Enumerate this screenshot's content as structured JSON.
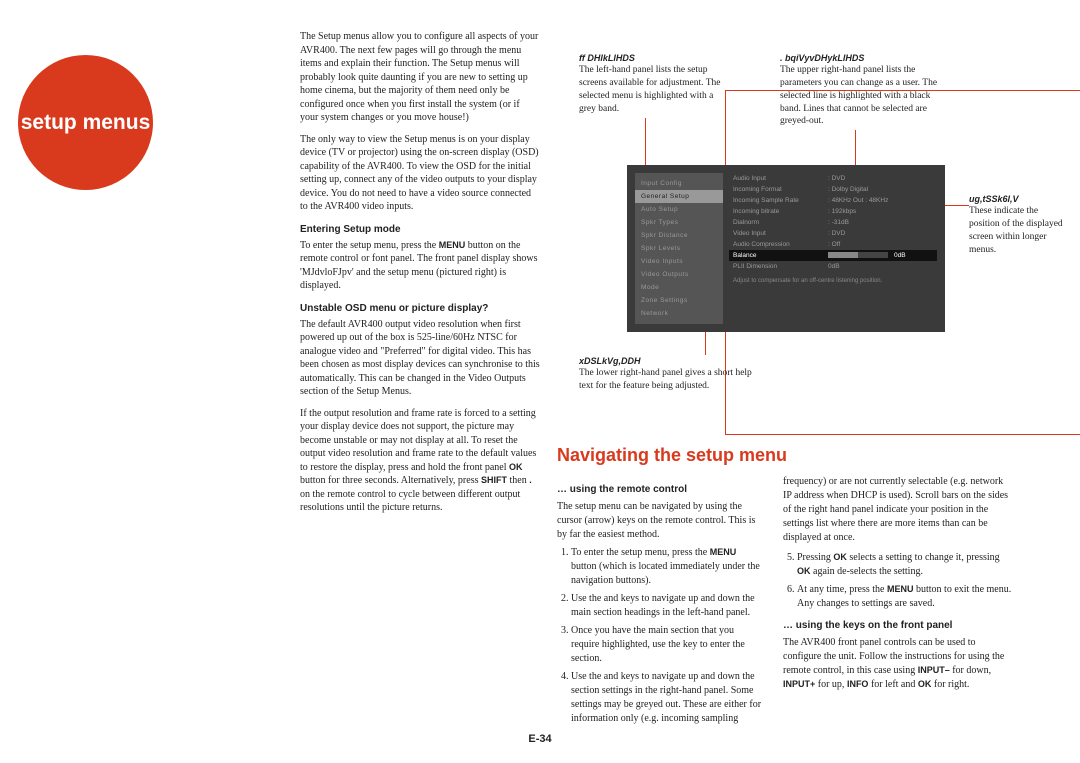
{
  "circle": {
    "label": "setup menus"
  },
  "intro": {
    "p1": "The Setup menus allow you to configure all aspects of your AVR400. The next few pages will go through the menu items and explain their function. The Setup menus will probably look quite daunting if you are new to setting up home cinema, but the majority of them need only be configured once when you first install the system (or if your system changes or you move house!)",
    "p2": "The only way to view the Setup menus is on your display device (TV or projector) using the on-screen display (OSD) capability of the AVR400. To view the OSD for the initial setting up, connect any of the video outputs to your display device. You do not need to have a video source connected to the AVR400 video inputs."
  },
  "entering": {
    "h": "Entering Setup mode",
    "p1a": "To enter the setup menu, press the ",
    "p1b": " button on the remote control or font panel. The front panel display shows '",
    "p1c": "' and the setup menu (pictured right) is displayed.",
    "menu": "MENU",
    "code": "MJdvloFJpv"
  },
  "unstable": {
    "h": "Unstable OSD menu or picture display?",
    "p1": "The default AVR400 output video resolution when first powered up out of the box is 525-line/60Hz NTSC for analogue video and \"Preferred\" for digital video. This has been chosen as most display devices can synchronise to this automatically. This can be changed in the Video Outputs section of the Setup Menus.",
    "p2a": "If the output resolution and frame rate is forced to a setting your display device does not support, the picture may become unstable or may not display at all. To reset the output video resolution and frame rate to the default values to restore the display, press and hold the front panel ",
    "p2b": " button for three seconds. Alternatively, press ",
    "p2c": " then ",
    "p2d": " on the remote control to cycle between different output resolutions until the picture returns.",
    "ok": "OK",
    "shift": "SHIFT",
    "dot": "."
  },
  "callouts": {
    "c1h": "ff DHlkLlHDS",
    "c1": "The left-hand panel lists the setup screens available for adjustment. The selected menu is highlighted with a grey band.",
    "c2h": ". bqiVyvDHykLlHDS",
    "c2": "The upper right-hand panel lists the parameters you can change as a user. The selected line is highlighted with a black band. Lines that cannot be selected are greyed-out.",
    "c3h": "ug,tSSk6l,V",
    "c3": "These indicate the position of the displayed screen within longer menus.",
    "c4h": "xDSLkVg,DDH",
    "c4": "The lower right-hand panel gives a short help text for the feature being adjusted."
  },
  "osd": {
    "left": [
      "Input Config",
      "General Setup",
      "Auto Setup",
      "Spkr Types",
      "Spkr Distance",
      "Spkr Levels",
      "Video Inputs",
      "Video Outputs",
      "Mode",
      "Zone Settings",
      "Network"
    ],
    "selectedLeft": 1,
    "rows": [
      {
        "k": "Audio Input",
        "v": ": DVD"
      },
      {
        "k": "Incoming Format",
        "v": ": Dolby Digital"
      },
      {
        "k": "Incoming Sample Rate",
        "v": ": 48KHz Out : 48KHz"
      },
      {
        "k": "Incoming bitrate",
        "v": ": 192kbps"
      },
      {
        "k": "Dialnorm",
        "v": ": -31dB"
      },
      {
        "k": "Video Input",
        "v": ": DVD"
      },
      {
        "k": "Audio Compression",
        "v": ": Off"
      },
      {
        "k": "Balance",
        "v": "0dB",
        "sel": true
      },
      {
        "k": "PLII Dimension",
        "v": "0dB"
      }
    ],
    "help": "Adjust to compensate for an off-centre listening position."
  },
  "nav": {
    "title": "Navigating the setup menu",
    "remote_h": "… using the remote control",
    "remote_p": "The setup menu can be navigated by using the cursor (arrow) keys on the remote control. This is by far the easiest method.",
    "li1a": "To enter the setup menu, press the ",
    "li1b": " button (which is located immediately under the navigation buttons).",
    "li2": "Use the        and        keys to navigate up and down the main section headings in the left-hand panel.",
    "li3": "Once you have the main section that you require highlighted, use the        key to enter the section.",
    "li4": "Use the        and        keys to navigate up and down the section settings in the right-hand panel. Some settings may be greyed out. These are either for information only (e.g. incoming sampling",
    "r_p1": "frequency) or are not currently selectable (e.g. network IP address when DHCP is used). Scroll bars on the sides of the right hand panel indicate your position in the settings list where there are more items than can be displayed at once.",
    "li5a": "Pressing ",
    "li5b": " selects a setting to change it, pressing ",
    "li5c": " again de-selects the setting.",
    "li6a": "At any time, press the ",
    "li6b": " button to exit the menu. Any changes to settings are saved.",
    "front_h": "… using the keys on the front panel",
    "front_pa": "The AVR400 front panel controls can be used to configure the unit. Follow the instructions for using the remote control, in this case using ",
    "front_pb": " for down, ",
    "front_pc": " for up, ",
    "front_pd": " for left and ",
    "front_pe": " for right.",
    "menu": "MENU",
    "ok": "OK",
    "inputminus": "INPUT–",
    "inputplus": "INPUT+",
    "info": "INFO"
  },
  "pagenum": "E-34"
}
